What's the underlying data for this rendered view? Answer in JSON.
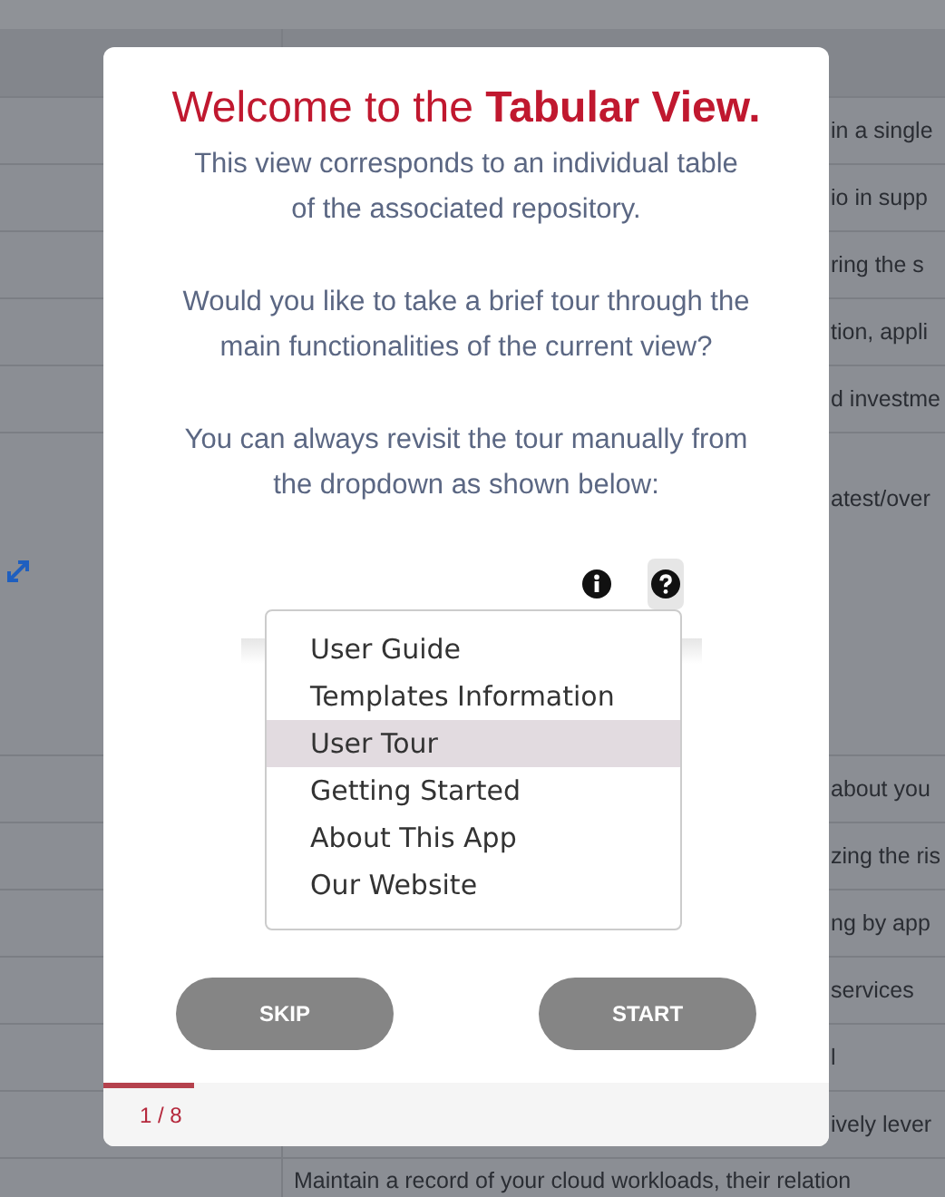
{
  "background_table": {
    "rows": [
      {
        "column_2": "in a single"
      },
      {
        "column_2": "io in supp"
      },
      {
        "column_2": "ring the s"
      },
      {
        "column_2": "tion, appli"
      },
      {
        "column_2": "d investme"
      },
      {
        "column_2": "atest/over",
        "tall": true
      },
      {
        "column_2": "about you"
      },
      {
        "column_2": "zing the ris"
      },
      {
        "column_2": "ng by app"
      },
      {
        "column_2": "services"
      },
      {
        "column_2": "l"
      },
      {
        "column_2": "ively lever"
      },
      {
        "column_2": "Maintain a record of your cloud workloads, their relation",
        "full": true
      }
    ]
  },
  "tour_dialog": {
    "title_start": "Welcome to the ",
    "title_bold": "Tabular View.",
    "paragraphs": [
      "This view corresponds to an individual table\nof the associated repository.",
      "Would you like to take a brief tour through the\nmain functionalities of the current view?",
      "You can always revisit the tour manually from\nthe dropdown as shown below:"
    ],
    "dropdown_items": [
      {
        "label": "User Guide",
        "selected": false
      },
      {
        "label": "Templates Information",
        "selected": false
      },
      {
        "label": "User Tour",
        "selected": true
      },
      {
        "label": "Getting Started",
        "selected": false
      },
      {
        "label": "About This App",
        "selected": false
      },
      {
        "label": "Our Website",
        "selected": false
      }
    ],
    "buttons": [
      "SKIP",
      "START"
    ],
    "progress": {
      "level": 0.125,
      "step": "1 / 8"
    }
  }
}
